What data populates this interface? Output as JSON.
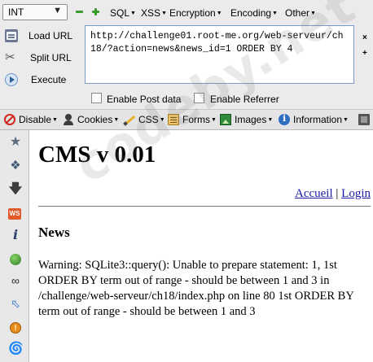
{
  "hackbar": {
    "type_select": "INT",
    "menus": [
      "SQL",
      "XSS",
      "Encryption",
      "Encoding",
      "Other"
    ],
    "actions": {
      "load": "Load URL",
      "split": "Split URL",
      "execute": "Execute"
    },
    "url": "http://challenge01.root-me.org/web-serveur/ch18/?action=news&news_id=1 ORDER BY 4",
    "side_buttons": [
      "×",
      "+"
    ],
    "checkboxes": {
      "post": "Enable Post data",
      "referrer": "Enable Referrer"
    }
  },
  "webdev_toolbar": {
    "items": [
      "Disable",
      "Cookies",
      "CSS",
      "Forms",
      "Images",
      "Information"
    ]
  },
  "sidebar": {
    "icons": [
      "bookmark-star-icon",
      "addons-puzzle-icon",
      "download-arrow-icon",
      "ws-icon",
      "info-i-icon",
      "green-globe-icon",
      "link-icon",
      "selector-icon",
      "orange-badge-icon",
      "swirl-icon"
    ]
  },
  "page": {
    "title": "CMS v 0.01",
    "nav": {
      "home": "Accueil",
      "separator": "|",
      "login": "Login"
    },
    "section_title": "News",
    "warning": "Warning: SQLite3::query(): Unable to prepare statement: 1, 1st ORDER BY term out of range - should be between 1 and 3 in /challenge/web-serveur/ch18/index.php on line 80 1st ORDER BY term out of range - should be between 1 and 3"
  },
  "watermark": "codeby.net",
  "colors": {
    "link": "#1a1aa6",
    "hackbar_bg": "#ebebeb",
    "url_border": "#7a9cc6",
    "green_button": "#3b9a2e"
  }
}
